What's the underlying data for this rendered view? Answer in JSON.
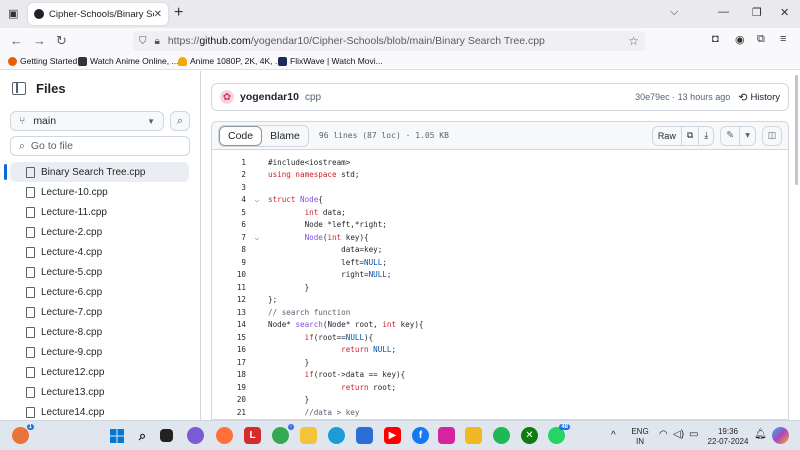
{
  "browser": {
    "tab_title": "Cipher-Schools/Binary Search Tr",
    "url_prefix": "https://",
    "url_host": "github.com",
    "url_path": "/yogendar10/Cipher-Schools/blob/main/Binary Search Tree.cpp",
    "bookmarks": [
      {
        "label": "Getting Started",
        "color": "#e66000"
      },
      {
        "label": "Watch Anime Online, ...",
        "color": "#333333"
      },
      {
        "label": "Anime 1080P, 2K, 4K, ...",
        "color": "#f2a900"
      },
      {
        "label": "FlixWave | Watch Movi...",
        "color": "#1c2b5a"
      }
    ]
  },
  "sidebar": {
    "title": "Files",
    "branch": "main",
    "goto_placeholder": "Go to file",
    "files": [
      "Binary Search Tree.cpp",
      "Lecture-10.cpp",
      "Lecture-11.cpp",
      "Lecture-2.cpp",
      "Lecture-4.cpp",
      "Lecture-5.cpp",
      "Lecture-6.cpp",
      "Lecture-7.cpp",
      "Lecture-8.cpp",
      "Lecture-9.cpp",
      "Lecture12.cpp",
      "Lecture13.cpp",
      "Lecture14.cpp"
    ]
  },
  "commit": {
    "author": "yogendar10",
    "message": "cpp",
    "meta": "30e79ec · 13 hours ago",
    "history_label": "History"
  },
  "file_header": {
    "code_tab": "Code",
    "blame_tab": "Blame",
    "info": "96 lines (87 loc) · 1.05 KB",
    "raw_label": "Raw"
  },
  "code_lines": [
    {
      "n": "1",
      "fold": "",
      "html": "<span class='txt'>#include&lt;iostream&gt;</span>"
    },
    {
      "n": "2",
      "fold": "",
      "html": "<span class='kw'>using namespace</span> <span class='txt'>std;</span>"
    },
    {
      "n": "3",
      "fold": "",
      "html": ""
    },
    {
      "n": "4",
      "fold": "⌵",
      "html": "<span class='kw'>struct</span> <span class='ent'>Node</span>{"
    },
    {
      "n": "5",
      "fold": "",
      "html": "        <span class='kw'>int</span> data;"
    },
    {
      "n": "6",
      "fold": "",
      "html": "        Node *left,*right;"
    },
    {
      "n": "7",
      "fold": "⌵",
      "html": "        <span class='ent'>Node</span>(<span class='kw'>int</span> key){"
    },
    {
      "n": "8",
      "fold": "",
      "html": "                data=key;"
    },
    {
      "n": "9",
      "fold": "",
      "html": "                left=<span class='cst'>NULL</span>;"
    },
    {
      "n": "10",
      "fold": "",
      "html": "                right=<span class='cst'>NULL</span>;"
    },
    {
      "n": "11",
      "fold": "",
      "html": "        }"
    },
    {
      "n": "12",
      "fold": "",
      "html": "};"
    },
    {
      "n": "13",
      "fold": "",
      "html": "<span class='cm'>// search function</span>"
    },
    {
      "n": "14",
      "fold": "",
      "html": "Node* <span class='ent'>search</span>(Node* root, <span class='kw'>int</span> key){"
    },
    {
      "n": "15",
      "fold": "",
      "html": "        <span class='kw'>if</span>(root==<span class='cst'>NULL</span>){"
    },
    {
      "n": "16",
      "fold": "",
      "html": "                <span class='kw'>return</span> <span class='cst'>NULL</span>;"
    },
    {
      "n": "17",
      "fold": "",
      "html": "        }"
    },
    {
      "n": "18",
      "fold": "",
      "html": "        <span class='kw'>if</span>(root-&gt;data == key){"
    },
    {
      "n": "19",
      "fold": "",
      "html": "                <span class='kw'>return</span> root;"
    },
    {
      "n": "20",
      "fold": "",
      "html": "        }"
    },
    {
      "n": "21",
      "fold": "",
      "html": "        <span class='cm'>//data &gt; key</span>"
    }
  ],
  "taskbar": {
    "lang": "ENG",
    "lang_sub": "IN",
    "time": "19:36",
    "date": "22-07-2024",
    "badge_a": "1",
    "badge_b": "48"
  }
}
